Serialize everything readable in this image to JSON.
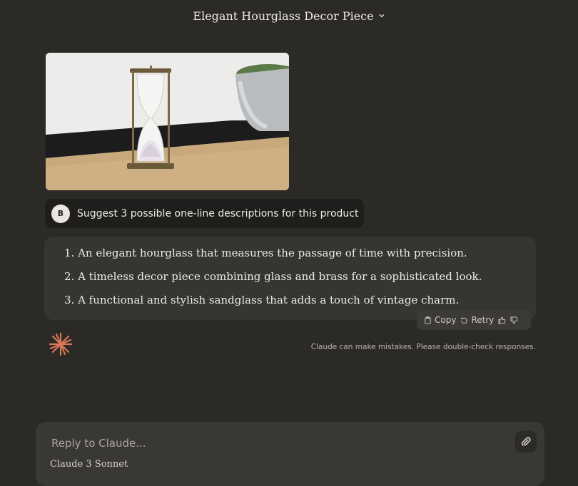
{
  "header": {
    "title": "Elegant Hourglass Decor Piece",
    "chevron_icon": "chevron-down-icon"
  },
  "user_message": {
    "avatar_initial": "B",
    "text": "Suggest 3 possible one-line descriptions for this product"
  },
  "assistant_message": {
    "items": [
      "1. An elegant hourglass that measures the passage of time with precision.",
      "2. A timeless decor piece combining glass and brass for a sophisticated look.",
      "3. A functional and stylish sandglass that adds a touch of vintage charm."
    ],
    "actions": {
      "copy": "Copy",
      "retry": "Retry"
    }
  },
  "disclaimer": "Claude can make mistakes. Please double-check responses.",
  "composer": {
    "placeholder": "Reply to Claude...",
    "model_name": "Claude",
    "model_version": "3 Sonnet"
  },
  "colors": {
    "accent_logo": "#d97757",
    "background": "#2b2a27"
  }
}
